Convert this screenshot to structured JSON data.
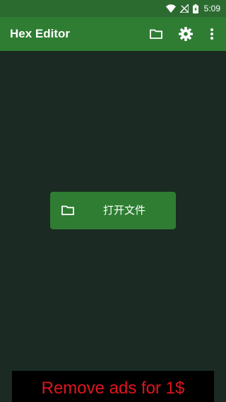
{
  "status_bar": {
    "time": "5:09",
    "icons": [
      "wifi-icon",
      "no-signal-icon",
      "battery-charging-icon"
    ]
  },
  "app_bar": {
    "title": "Hex Editor",
    "actions": [
      "folder-icon",
      "gear-icon",
      "more-vert-icon"
    ]
  },
  "main": {
    "open_file_button": {
      "label": "打开文件",
      "icon": "folder-icon"
    }
  },
  "ad_banner": {
    "text": "Remove ads for 1$"
  },
  "colors": {
    "status_bar": "#2b6b30",
    "app_bar": "#2e7d32",
    "background": "#1b2a22",
    "button": "#2e7d32",
    "ad_background": "#000000",
    "ad_text": "#e0141e"
  }
}
